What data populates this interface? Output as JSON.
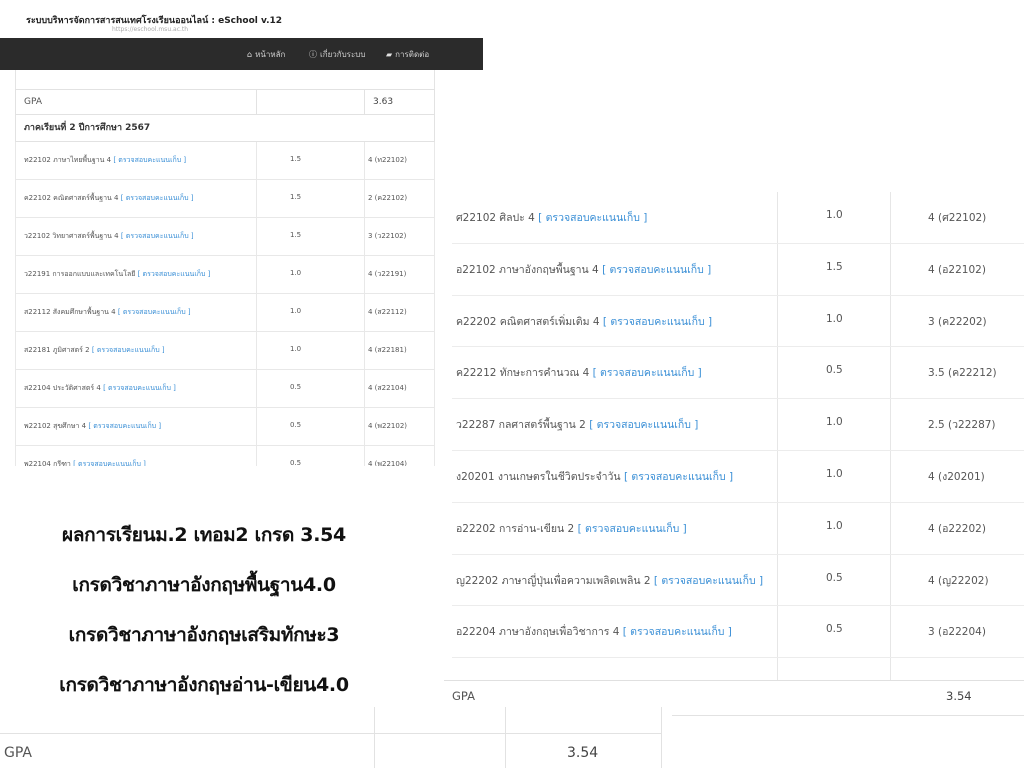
{
  "screenshot_top_left": {
    "app_title": "ระบบบริหารจัดการสารสนเทศโรงเรียนออนไลน์ : eSchool v.12",
    "app_url": "https://eschool.msu.ac.th",
    "nav": [
      {
        "label": "หน้าหลัก",
        "icon": "home-icon",
        "glyph": "⌂"
      },
      {
        "label": "เกี่ยวกับระบบ",
        "icon": "info-icon",
        "glyph": "ⓘ"
      },
      {
        "label": "การติดต่อ",
        "icon": "chat-icon",
        "glyph": "▰"
      }
    ],
    "gpa_label": "GPA",
    "gpa_value": "3.63",
    "term_title": "ภาคเรียนที่ 2 ปีการศึกษา 2567",
    "check_link": "[ ตรวจสอบคะแนนเก็บ ]",
    "rows": [
      {
        "subject": "ท22102 ภาษาไทยพื้นฐาน 4",
        "credit": "1.5",
        "grade": "4 (ท22102)"
      },
      {
        "subject": "ค22102 คณิตศาสตร์พื้นฐาน 4",
        "credit": "1.5",
        "grade": "2 (ค22102)"
      },
      {
        "subject": "ว22102 วิทยาศาสตร์พื้นฐาน 4",
        "credit": "1.5",
        "grade": "3 (ว22102)"
      },
      {
        "subject": "ว22191 การออกแบบและเทคโนโลยี",
        "credit": "1.0",
        "grade": "4 (ว22191)"
      },
      {
        "subject": "ส22112 สังคมศึกษาพื้นฐาน 4",
        "credit": "1.0",
        "grade": "4 (ส22112)"
      },
      {
        "subject": "ส22181 ภูมิศาสตร์ 2",
        "credit": "1.0",
        "grade": "4 (ส22181)"
      },
      {
        "subject": "ส22104 ประวัติศาสตร์ 4",
        "credit": "0.5",
        "grade": "4 (ส22104)"
      },
      {
        "subject": "พ22102 สุขศึกษา 4",
        "credit": "0.5",
        "grade": "4 (พ22102)"
      },
      {
        "subject": "พ22104 กรีฑา",
        "credit": "0.5",
        "grade": "4 (พ22104)"
      }
    ]
  },
  "screenshot_right": {
    "check_link": "[ ตรวจสอบคะแนนเก็บ ]",
    "rows": [
      {
        "subject": "ศ22102 ศิลปะ 4",
        "credit": "1.0",
        "grade": "4 (ศ22102)"
      },
      {
        "subject": "อ22102 ภาษาอังกฤษพื้นฐาน 4",
        "credit": "1.5",
        "grade": "4 (อ22102)"
      },
      {
        "subject": "ค22202 คณิตศาสตร์เพิ่มเติม 4",
        "credit": "1.0",
        "grade": "3 (ค22202)"
      },
      {
        "subject": "ค22212 ทักษะการคำนวณ 4",
        "credit": "0.5",
        "grade": "3.5 (ค22212)"
      },
      {
        "subject": "ว22287 กลศาสตร์พื้นฐาน 2",
        "credit": "1.0",
        "grade": "2.5 (ว22287)"
      },
      {
        "subject": "ง20201 งานเกษตรในชีวิตประจำวัน",
        "credit": "1.0",
        "grade": "4 (ง20201)"
      },
      {
        "subject": "อ22202 การอ่าน-เขียน 2",
        "credit": "1.0",
        "grade": "4 (อ22202)"
      },
      {
        "subject": "ญ22202 ภาษาญี่ปุ่นเพื่อความเพลิดเพลิน 2",
        "credit": "0.5",
        "grade": "4 (ญ22202)"
      },
      {
        "subject": "อ22204 ภาษาอังกฤษเพื่อวิชาการ 4",
        "credit": "0.5",
        "grade": "3 (อ22204)"
      }
    ],
    "gpa_label": "GPA",
    "gpa_value": "3.54"
  },
  "bottom_strip": {
    "gpa_label": "GPA",
    "gpa_value": "3.54"
  },
  "caption_lines": [
    "ผลการเรียนม.2 เทอม2 เกรด 3.54",
    "เกรดวิชาภาษาอังกฤษพื้นฐาน4.0",
    "เกรดวิชาภาษาอังกฤษเสริมทักษะ3",
    "เกรดวิชาภาษาอังกฤษอ่าน-เขียน4.0"
  ]
}
